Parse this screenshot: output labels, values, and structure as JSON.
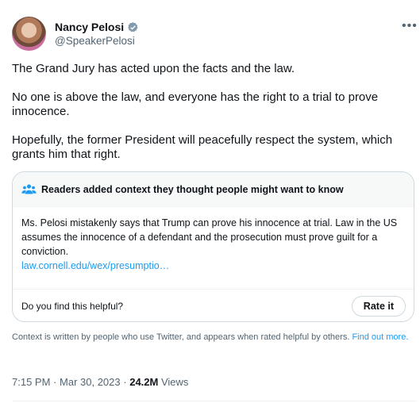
{
  "author": {
    "display_name": "Nancy Pelosi",
    "handle": "@SpeakerPelosi",
    "verified_icon": "verified-badge-icon",
    "verified_color": "#829aab"
  },
  "tweet": {
    "paragraphs": [
      "The Grand Jury has acted upon the facts and the law.",
      "No one is above the law, and everyone has the right to a trial to prove innocence.",
      "Hopefully, the former President will peacefully respect the system, which grants him that right."
    ]
  },
  "community_note": {
    "header": "Readers added context they thought people might want to know",
    "body": "Ms. Pelosi mistakenly says that Trump can prove his innocence at trial. Law in the US assumes the innocence of a defendant and the prosecution must prove guilt for a conviction.",
    "link_text": "law.cornell.edu/wex/presumptio…",
    "question": "Do you find this helpful?",
    "rate_label": "Rate it"
  },
  "disclaimer": {
    "text": "Context is written by people who use Twitter, and appears when rated helpful by others.",
    "link": "Find out more."
  },
  "meta": {
    "time": "7:15 PM",
    "date": "Mar 30, 2023",
    "views_count": "24.2M",
    "views_label": "Views",
    "separator": "·"
  },
  "icons": {
    "more": "more-options-icon",
    "people": "people-icon"
  },
  "colors": {
    "link": "#1d9bf0",
    "secondary_text": "#536471",
    "border": "#cfd9de"
  }
}
